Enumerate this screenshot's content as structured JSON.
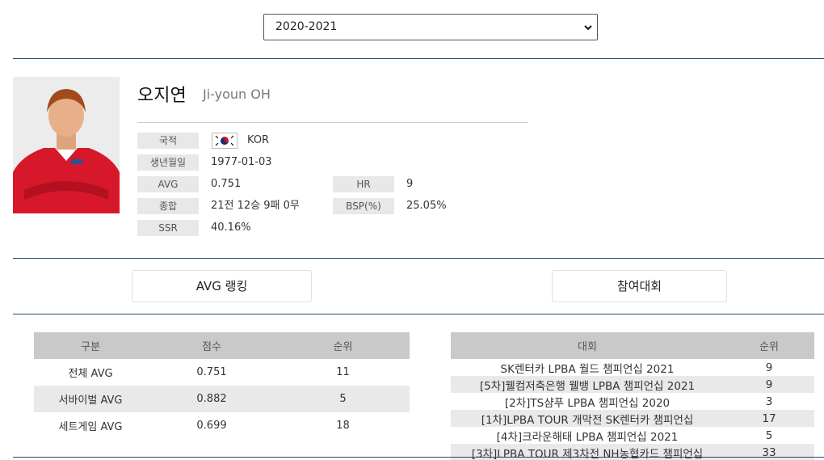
{
  "season_select": {
    "value": "2020-2021"
  },
  "player": {
    "name_ko": "오지연",
    "name_en": "Ji-youn OH",
    "photo_icon": "player-photo"
  },
  "info": {
    "nationality_label": "국적",
    "nationality_value": "KOR",
    "flag_icon": "korea-flag-icon",
    "birth_label": "생년월일",
    "birth_value": "1977-01-03",
    "avg_label": "AVG",
    "avg_value": "0.751",
    "hr_label": "HR",
    "hr_value": "9",
    "record_label": "종합",
    "record_value": "21전 12승 9패 0무",
    "bsp_label": "BSP(%)",
    "bsp_value": "25.05%",
    "ssr_label": "SSR",
    "ssr_value": "40.16%"
  },
  "tabs": {
    "avg_ranking": "AVG 랭킹",
    "tournaments": "참여대회"
  },
  "avg_table": {
    "headers": [
      "구분",
      "점수",
      "순위"
    ],
    "rows": [
      [
        "전체 AVG",
        "0.751",
        "11"
      ],
      [
        "서바이벌 AVG",
        "0.882",
        "5"
      ],
      [
        "세트게임 AVG",
        "0.699",
        "18"
      ]
    ]
  },
  "tournament_table": {
    "headers": [
      "대회",
      "순위"
    ],
    "rows": [
      [
        "SK렌터카 LPBA 월드 챔피언십 2021",
        "9"
      ],
      [
        "[5차]웰컴저축은행 웰뱅 LPBA 챔피언십 2021",
        "9"
      ],
      [
        "[2차]TS샴푸 LPBA 챔피언십 2020",
        "3"
      ],
      [
        "[1차]LPBA TOUR 개막전 SK렌터카 챔피언십",
        "17"
      ],
      [
        "[4차]크라운해태 LPBA 챔피언십 2021",
        "5"
      ],
      [
        "[3차]LPBA TOUR 제3차전 NH농협카드 챔피언십",
        "33"
      ]
    ]
  },
  "colors": {
    "divider": "#23466b",
    "label_bg": "#e8e8e8",
    "header_bg": "#c9c9c9"
  }
}
